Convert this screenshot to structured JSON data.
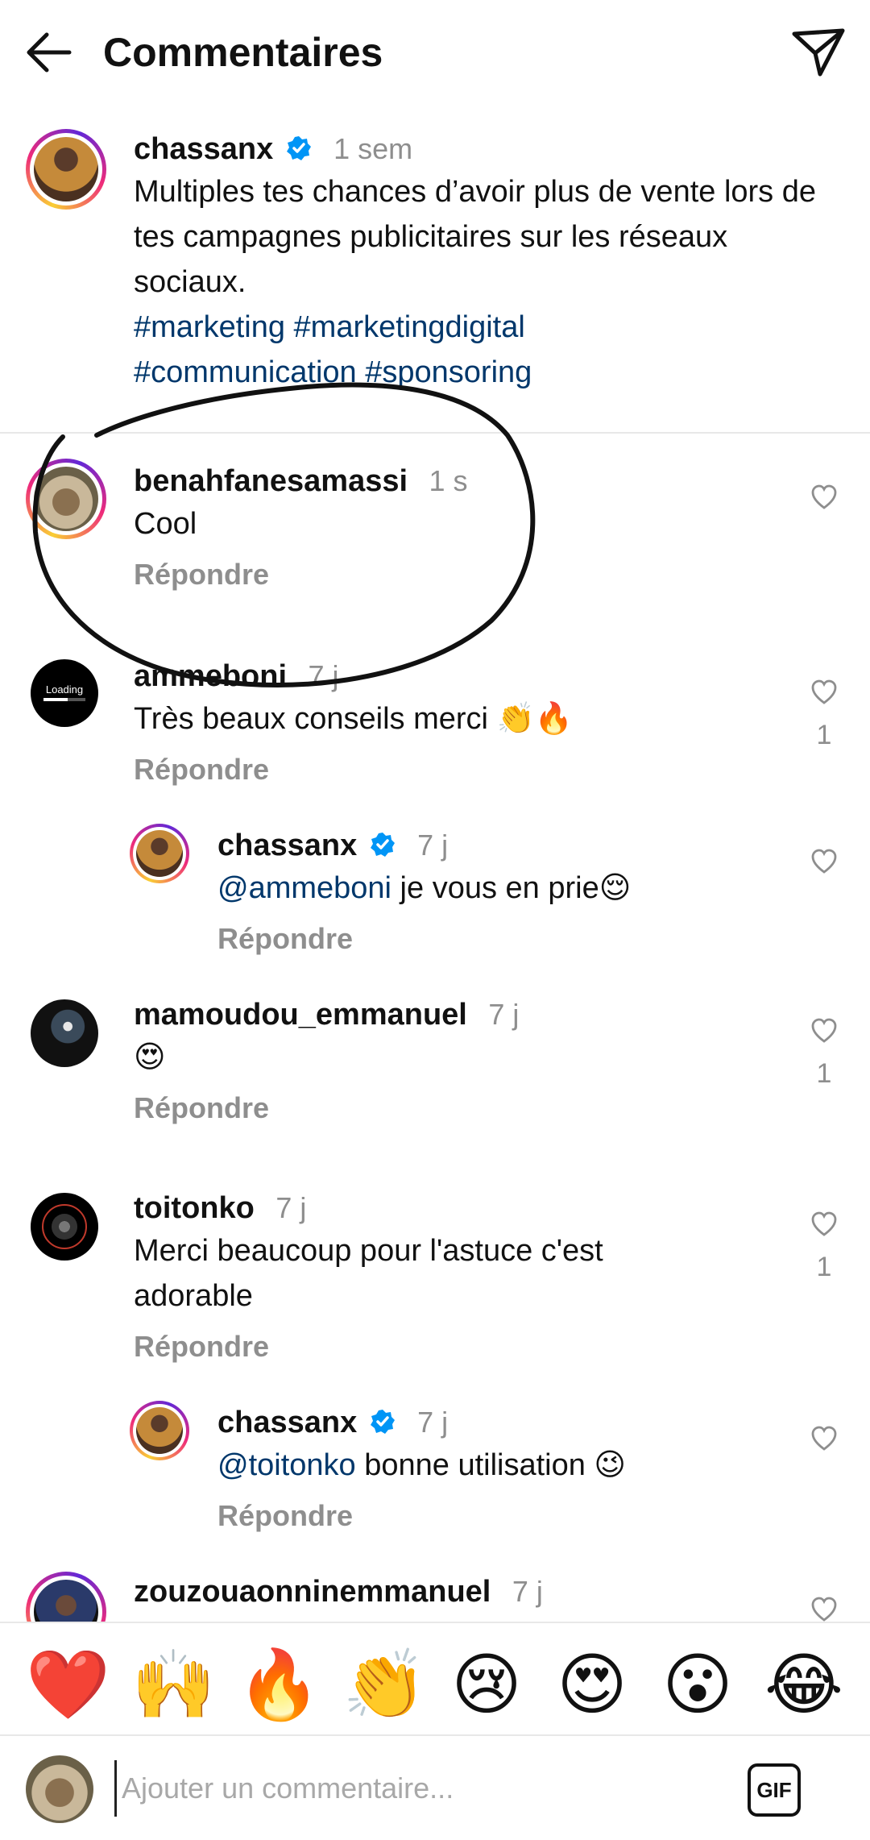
{
  "header": {
    "title": "Commentaires"
  },
  "post": {
    "username": "chassanx",
    "time": "1 sem",
    "caption": "Multiples tes chances d’avoir plus de vente lors de tes campagnes publicitaires sur les réseaux sociaux.",
    "hashtags_line1": "#marketing #marketingdigital",
    "hashtags_line2": "#communication #sponsoring"
  },
  "comments": [
    {
      "username": "benahfanesamassi",
      "time": "1 s",
      "text": "Cool",
      "reply": "Répondre",
      "likes": ""
    },
    {
      "username": "ammeboni",
      "time": "7 j",
      "text": "Très beaux conseils merci 👏🔥",
      "reply": "Répondre",
      "likes": "1"
    },
    {
      "username": "chassanx",
      "time": "7 j",
      "mention": "@ammeboni",
      "text": " je vous en prie😌",
      "reply": "Répondre",
      "likes": ""
    },
    {
      "username": "mamoudou_emmanuel",
      "time": "7 j",
      "text": "😍",
      "reply": "Répondre",
      "likes": "1"
    },
    {
      "username": "toitonko",
      "time": "7 j",
      "text": "Merci beaucoup pour l'astuce c'est adorable",
      "reply": "Répondre",
      "likes": "1"
    },
    {
      "username": "chassanx",
      "time": "7 j",
      "mention": "@toitonko",
      "text": " bonne utilisation 😉",
      "reply": "Répondre",
      "likes": ""
    },
    {
      "username": "zouzouaonninemmanuel",
      "time": "7 j"
    }
  ],
  "avatar_labels": {
    "loading": "Loading"
  },
  "emoji_bar": [
    "❤️",
    "🙌",
    "🔥",
    "👏",
    "😢",
    "😍",
    "😮",
    "😂"
  ],
  "composer": {
    "placeholder": "Ajouter un commentaire...",
    "gif_label": "GIF"
  },
  "colors": {
    "link": "#00376b",
    "muted": "#8e8e8e",
    "verified": "#0095f6"
  }
}
